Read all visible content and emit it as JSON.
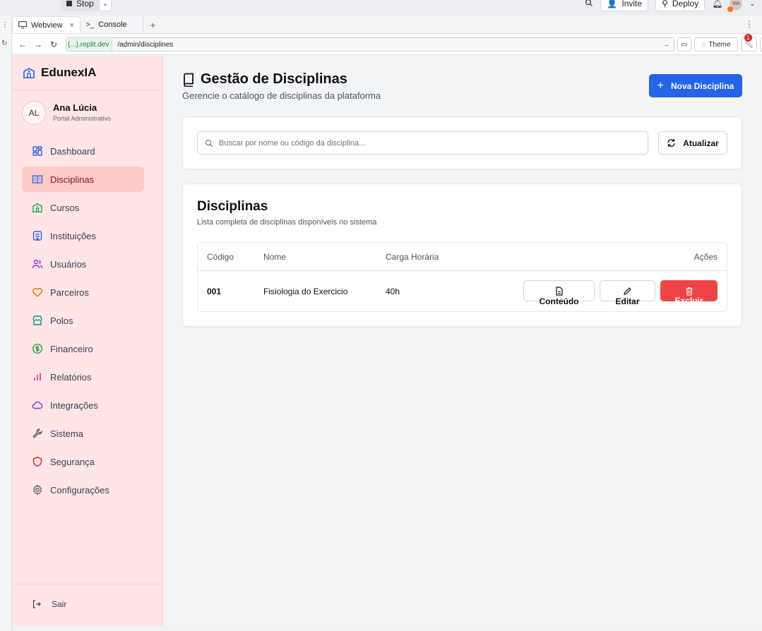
{
  "ide": {
    "stop_label": "Stop",
    "invite_label": "Invite",
    "deploy_label": "Deploy",
    "user_initials": "MA",
    "tabs": [
      {
        "label": "Webview"
      },
      {
        "label": "Console"
      }
    ],
    "url_host": "{...}.replit.dev",
    "url_path": "/admin/disciplines",
    "theme_label": "Theme",
    "notification_count": "1"
  },
  "sidebar": {
    "brand": "EdunexIA",
    "user_initials": "AL",
    "user_name": "Ana Lúcia",
    "user_role": "Portal Administrativo",
    "items": [
      {
        "label": "Dashboard",
        "icon": "grid-icon",
        "color": "#2563eb"
      },
      {
        "label": "Disciplinas",
        "icon": "book-open-icon",
        "color": "#2563eb",
        "active": true
      },
      {
        "label": "Cursos",
        "icon": "school-icon",
        "color": "#16a34a"
      },
      {
        "label": "Instituições",
        "icon": "building-icon",
        "color": "#2563eb"
      },
      {
        "label": "Usuários",
        "icon": "users-icon",
        "color": "#9333ea"
      },
      {
        "label": "Parceiros",
        "icon": "heart-icon",
        "color": "#d97706"
      },
      {
        "label": "Polos",
        "icon": "store-icon",
        "color": "#0d9488"
      },
      {
        "label": "Financeiro",
        "icon": "dollar-icon",
        "color": "#16a34a"
      },
      {
        "label": "Relatórios",
        "icon": "bar-chart-icon",
        "color": "#db2777"
      },
      {
        "label": "Integrações",
        "icon": "cloud-icon",
        "color": "#7c3aed"
      },
      {
        "label": "Sistema",
        "icon": "wrench-icon",
        "color": "#4b5563"
      },
      {
        "label": "Segurança",
        "icon": "shield-icon",
        "color": "#dc2626"
      },
      {
        "label": "Configurações",
        "icon": "gear-icon",
        "color": "#4b5563"
      }
    ],
    "logout_label": "Sair"
  },
  "page": {
    "title": "Gestão de Disciplinas",
    "subtitle": "Gerencie o catálogo de disciplinas da plataforma",
    "new_button": "Nova Disciplina",
    "search_placeholder": "Buscar por nome ou código da disciplina...",
    "refresh_button": "Atualizar",
    "list_title": "Disciplinas",
    "list_subtitle": "Lista completa de disciplinas disponíveis no sistema",
    "columns": [
      "Código",
      "Nome",
      "Carga Horária",
      "Ações"
    ],
    "rows": [
      {
        "code": "001",
        "name": "Fisiologia do Exercicio",
        "hours": "40h"
      }
    ],
    "actions": {
      "content": "Conteúdo",
      "edit": "Editar",
      "delete": "Excluir"
    }
  },
  "colors": {
    "primary": "#2563eb",
    "danger": "#ef4444",
    "sidebar_bg": "#ffe5e5",
    "active_bg": "#fecaca"
  }
}
